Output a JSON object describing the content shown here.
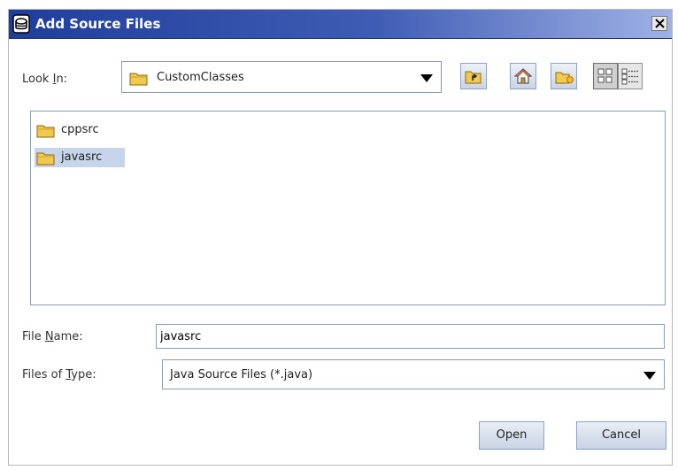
{
  "window": {
    "title": "Add Source Files",
    "close_label": "X"
  },
  "look_in": {
    "label_prefix": "Look ",
    "label_mnemonic": "I",
    "label_suffix": "n:",
    "value": "CustomClasses"
  },
  "toolbar": {
    "buttons": [
      {
        "icon": "up-one-level-icon"
      },
      {
        "icon": "home-icon"
      },
      {
        "icon": "new-folder-icon"
      },
      {
        "icon": "list-view-icon",
        "pressed": true
      },
      {
        "icon": "details-view-icon"
      }
    ]
  },
  "files": [
    {
      "name": "cppsrc",
      "icon": "folder-icon",
      "selected": false
    },
    {
      "name": "javasrc",
      "icon": "folder-icon",
      "selected": true
    }
  ],
  "file_name": {
    "label_prefix": "File ",
    "label_mnemonic": "N",
    "label_suffix": "ame:",
    "value": "javasrc"
  },
  "file_type": {
    "label_prefix": "Files of ",
    "label_mnemonic": "T",
    "label_suffix": "ype:",
    "value": "Java Source Files (*.java)"
  },
  "buttons": {
    "open": "Open",
    "cancel": "Cancel"
  },
  "colors": {
    "titlebar_start": "#1f3e9b",
    "titlebar_end": "#9fb2e6",
    "selection": "#c7d5ea",
    "border": "#8c9bb5"
  }
}
